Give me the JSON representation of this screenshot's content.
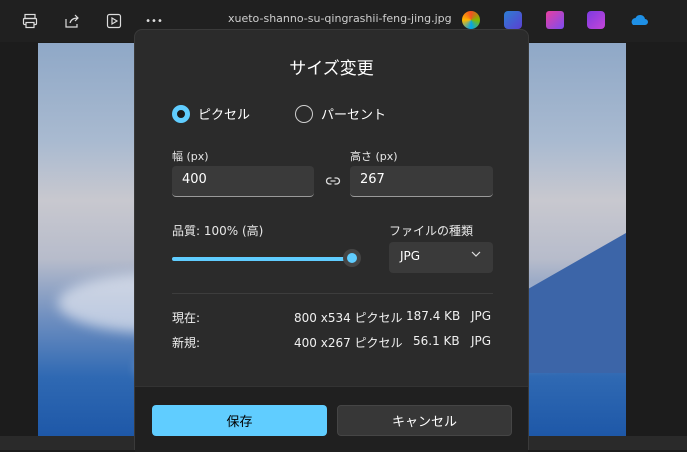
{
  "toolbar": {
    "filename": "xueto-shanno-su-qingrashii-feng-jing.jpg",
    "more_label": "•••"
  },
  "dialog": {
    "title": "サイズ変更",
    "radio_pixels": "ピクセル",
    "radio_percent": "パーセント",
    "width_label": "幅 (px)",
    "width_value": "400",
    "height_label": "高さ (px)",
    "height_value": "267",
    "quality_label": "品質: 100% (高)",
    "quality_level": 1.0,
    "filetype_label": "ファイルの種類",
    "filetype_value": "JPG",
    "current": {
      "label": "現在:",
      "dims": "800 x534 ピクセル",
      "size": "187.4 KB",
      "type": "JPG"
    },
    "new": {
      "label": "新規:",
      "dims": "400 x267 ピクセル",
      "size": "56.1 KB",
      "type": "JPG"
    },
    "save": "保存",
    "cancel": "キャンセル"
  },
  "colors": {
    "accent": "#60cdff",
    "dialog_bg": "#2b2b2b"
  }
}
